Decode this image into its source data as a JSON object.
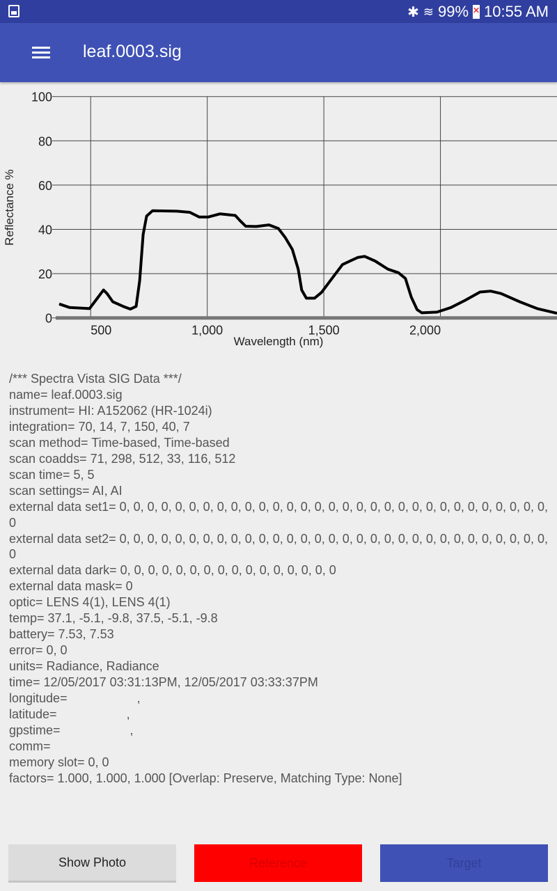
{
  "status_bar": {
    "battery": "99%",
    "time": "10:55 AM",
    "icons": [
      "gallery-icon",
      "bluetooth-icon",
      "wifi-icon",
      "battery-icon"
    ]
  },
  "app_bar": {
    "title": "leaf.0003.sig",
    "menu_icon": "hamburger-menu-icon"
  },
  "chart_data": {
    "type": "line",
    "xlabel": "Wavelength (nm)",
    "ylabel": "Reflectance %",
    "xlim": [
      350,
      2500
    ],
    "ylim": [
      0,
      100
    ],
    "xticks": [
      500,
      1000,
      1500,
      2000
    ],
    "xtick_labels": [
      "500",
      "1,000",
      "1,500",
      "2,000"
    ],
    "yticks": [
      0,
      20,
      40,
      60,
      80,
      100
    ],
    "ytick_labels": [
      "0",
      "20",
      "40",
      "60",
      "80",
      "100"
    ],
    "grid": true,
    "line_color": "#000000",
    "series": [
      {
        "x": [
          365,
          410,
          495,
          525,
          555,
          570,
          595,
          640,
          670,
          695,
          710,
          725,
          740,
          765,
          870,
          925,
          965,
          1005,
          1055,
          1120,
          1140,
          1165,
          1210,
          1265,
          1305,
          1335,
          1365,
          1390,
          1405,
          1425,
          1460,
          1490,
          1535,
          1580,
          1645,
          1675,
          1720,
          1775,
          1820,
          1850,
          1875,
          1900,
          1920,
          1985,
          2045,
          2105,
          2170,
          2215,
          2260,
          2340,
          2415,
          2500
        ],
        "y": [
          6.3,
          4.7,
          4.2,
          8.4,
          12.6,
          11,
          7.3,
          5.2,
          4,
          5.2,
          16.8,
          37.7,
          46,
          48.4,
          48.2,
          47.7,
          45.6,
          45.6,
          47,
          46.3,
          44,
          41.4,
          41.3,
          42,
          40.4,
          36.2,
          30.9,
          22,
          12.6,
          8.9,
          8.9,
          11.5,
          17.8,
          24.1,
          27.3,
          27.8,
          25.7,
          22,
          20.4,
          17.8,
          9.4,
          3.7,
          2.3,
          2.6,
          4.7,
          7.9,
          11.7,
          12.1,
          11,
          7.3,
          4.2,
          2.1
        ]
      }
    ]
  },
  "metadata_lines": [
    "/*** Spectra Vista SIG Data ***/",
    "name= leaf.0003.sig",
    "instrument= HI: A152062 (HR-1024i)",
    "integration= 70, 14, 7, 150, 40, 7",
    "scan method= Time-based, Time-based",
    "scan coadds= 71, 298, 512, 33, 116, 512",
    "scan time= 5, 5",
    "scan settings= AI, AI",
    "external data set1= 0, 0, 0, 0, 0, 0, 0, 0, 0, 0, 0, 0, 0, 0, 0, 0, 0, 0, 0, 0, 0, 0, 0, 0, 0, 0, 0, 0, 0, 0, 0, 0",
    "external data set2= 0, 0, 0, 0, 0, 0, 0, 0, 0, 0, 0, 0, 0, 0, 0, 0, 0, 0, 0, 0, 0, 0, 0, 0, 0, 0, 0, 0, 0, 0, 0, 0",
    "external data dark= 0, 0, 0, 0, 0, 0, 0, 0, 0, 0, 0, 0, 0, 0, 0, 0",
    "external data mask= 0",
    "optic= LENS 4(1), LENS 4(1)",
    "temp= 37.1, -5.1, -9.8, 37.5, -5.1, -9.8",
    "battery= 7.53, 7.53",
    "error= 0, 0",
    "units= Radiance, Radiance",
    "time= 12/05/2017 03:31:13PM, 12/05/2017 03:33:37PM",
    "longitude=                    ,",
    "latitude=                    ,",
    "gpstime=                    ,",
    "comm=",
    "memory slot= 0, 0",
    "factors= 1.000, 1.000, 1.000 [Overlap: Preserve, Matching Type: None]"
  ],
  "buttons": {
    "show_photo": "Show Photo",
    "reference": "Reference",
    "target": "Target"
  },
  "colors": {
    "status_bar": "#303f9f",
    "app_bar": "#3f51b5",
    "reference": "#ff0000",
    "target": "#3f51b5"
  }
}
